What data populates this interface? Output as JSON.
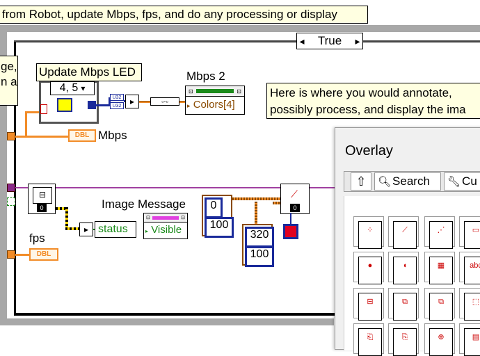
{
  "top_comment": "from Robot, update Mbps, fps, and do any processing or display",
  "case_selector": {
    "value": "True",
    "left_arrow": "◂",
    "right_arrow": "▸"
  },
  "left_comment": "ge,\nn a",
  "led_case": {
    "label": "Update Mbps LED",
    "selector": "4, 5",
    "dropdown_arrow": "▾"
  },
  "mbps2": {
    "label": "Mbps 2",
    "property": "Colors[4]"
  },
  "mbps_terminal": {
    "type": "DBL",
    "label": "Mbps"
  },
  "fps_terminal": {
    "type": "DBL",
    "label": "fps"
  },
  "image_message": {
    "label": "Image Message",
    "status": "status",
    "visible": "Visible"
  },
  "annotation_comment": "Here is where you would annotate,\npossibly process, and display the ima",
  "constants": {
    "a": "0",
    "b": "100",
    "c": "320",
    "d": "100"
  },
  "small_zero": "0",
  "palette": {
    "title": "Overlay",
    "up_label": "",
    "search_label": "Search",
    "customize_label": "Cu"
  },
  "colors": {
    "wire_orange": "#f28c28",
    "wire_blue": "#1a2a9a",
    "comment_bg": "#ffffe1",
    "frame_gray": "#a8a8a8",
    "led_yellow": "#ffff00",
    "mbps_green": "#1a8a1a"
  }
}
